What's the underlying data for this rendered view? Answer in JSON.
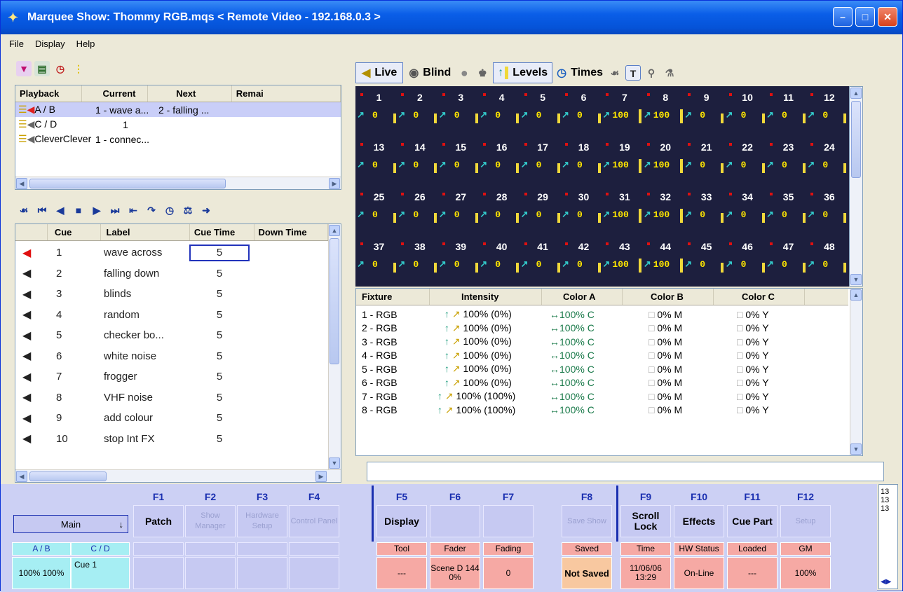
{
  "window": {
    "title": "Marquee Show: Thommy RGB.mqs  < Remote Video - 192.168.0.3 >"
  },
  "menu": [
    "File",
    "Display",
    "Help"
  ],
  "playback": {
    "headers": [
      "Playback",
      "Current",
      "Next",
      "Remai"
    ],
    "rows": [
      {
        "name": "A / B",
        "current": "1 - wave a...",
        "next": "2 - falling ..."
      },
      {
        "name": "C / D",
        "current": "1",
        "next": ""
      },
      {
        "name": "CleverClever",
        "current": "1 - connec...",
        "next": ""
      }
    ]
  },
  "cues": {
    "headers": [
      "Cue",
      "Label",
      "Cue Time",
      "Down Time"
    ],
    "rows": [
      {
        "cue": "1",
        "label": "wave across",
        "time": "5"
      },
      {
        "cue": "2",
        "label": "falling down",
        "time": "5"
      },
      {
        "cue": "3",
        "label": "blinds",
        "time": "5"
      },
      {
        "cue": "4",
        "label": "random",
        "time": "5"
      },
      {
        "cue": "5",
        "label": "checker bo...",
        "time": "5"
      },
      {
        "cue": "6",
        "label": "white noise",
        "time": "5"
      },
      {
        "cue": "7",
        "label": "frogger",
        "time": "5"
      },
      {
        "cue": "8",
        "label": "VHF noise",
        "time": "5"
      },
      {
        "cue": "9",
        "label": "add colour",
        "time": "5"
      },
      {
        "cue": "10",
        "label": "stop Int FX",
        "time": "5"
      }
    ]
  },
  "toolbar": {
    "live": "Live",
    "blind": "Blind",
    "levels": "Levels",
    "times": "Times"
  },
  "channels": {
    "numbers": [
      "1",
      "2",
      "3",
      "4",
      "5",
      "6",
      "7",
      "8",
      "9",
      "10",
      "11",
      "12",
      "13",
      "14",
      "15",
      "16",
      "17",
      "18",
      "19",
      "20",
      "21",
      "22",
      "23",
      "24",
      "25",
      "26",
      "27",
      "28",
      "29",
      "30",
      "31",
      "32",
      "33",
      "34",
      "35",
      "36",
      "37",
      "38",
      "39",
      "40",
      "41",
      "42",
      "43",
      "44",
      "45",
      "46",
      "47",
      "48"
    ],
    "levels": [
      "0",
      "0",
      "0",
      "0",
      "0",
      "0",
      "100",
      "100",
      "0",
      "0",
      "0",
      "0"
    ]
  },
  "fixtures": {
    "headers": [
      "Fixture",
      "Intensity",
      "Color A",
      "Color B",
      "Color C"
    ],
    "rows": [
      {
        "fixture": "1 - RGB",
        "intensity": "100% (0%)",
        "a": "↔100% C",
        "b": "0% M",
        "c": "0% Y"
      },
      {
        "fixture": "2 - RGB",
        "intensity": "100% (0%)",
        "a": "↔100% C",
        "b": "0% M",
        "c": "0% Y"
      },
      {
        "fixture": "3 - RGB",
        "intensity": "100% (0%)",
        "a": "↔100% C",
        "b": "0% M",
        "c": "0% Y"
      },
      {
        "fixture": "4 - RGB",
        "intensity": "100% (0%)",
        "a": "↔100% C",
        "b": "0% M",
        "c": "0% Y"
      },
      {
        "fixture": "5 - RGB",
        "intensity": "100% (0%)",
        "a": "↔100% C",
        "b": "0% M",
        "c": "0% Y"
      },
      {
        "fixture": "6 - RGB",
        "intensity": "100% (0%)",
        "a": "↔100% C",
        "b": "0% M",
        "c": "0% Y"
      },
      {
        "fixture": "7 - RGB",
        "intensity": "100% (100%)",
        "a": "↔100% C",
        "b": "0% M",
        "c": "0% Y"
      },
      {
        "fixture": "8 - RGB",
        "intensity": "100% (100%)",
        "a": "↔100% C",
        "b": "0% M",
        "c": "0% Y"
      }
    ]
  },
  "fkeys": [
    {
      "key": "F1",
      "label": "Patch",
      "enabled": true
    },
    {
      "key": "F2",
      "label": "Show Manager",
      "enabled": false
    },
    {
      "key": "F3",
      "label": "Hardware Setup",
      "enabled": false
    },
    {
      "key": "F4",
      "label": "Control Panel",
      "enabled": false
    },
    {
      "key": "F5",
      "label": "Display",
      "enabled": true
    },
    {
      "key": "F6",
      "label": "",
      "enabled": true
    },
    {
      "key": "F7",
      "label": "",
      "enabled": true
    },
    {
      "key": "F8",
      "label": "Save Show",
      "enabled": false
    },
    {
      "key": "F9",
      "label": "Scroll Lock",
      "enabled": true
    },
    {
      "key": "F10",
      "label": "Effects",
      "enabled": true
    },
    {
      "key": "F11",
      "label": "Cue Part",
      "enabled": true
    },
    {
      "key": "F12",
      "label": "Setup",
      "enabled": false
    }
  ],
  "main_select": "Main",
  "faders": {
    "ab": "A / B",
    "cd": "C / D",
    "ab_values": "100% 100%",
    "cd_value": "Cue 1"
  },
  "status": [
    {
      "label": "Tool",
      "value": "---"
    },
    {
      "label": "Fader",
      "value": "Scene D 144 0%"
    },
    {
      "label": "Fading",
      "value": "0"
    },
    {
      "label": "Saved",
      "value": "Not Saved"
    },
    {
      "label": "Time",
      "value": "11/06/06 13:29"
    },
    {
      "label": "HW Status",
      "value": "On-Line"
    },
    {
      "label": "Loaded",
      "value": "---"
    },
    {
      "label": "GM",
      "value": "100%"
    }
  ],
  "side_numbers": [
    "13",
    "13",
    "13"
  ],
  "colors": {
    "titlebar": "#0a5ee8",
    "stage": "#1d1f3e",
    "level_text": "#ffe600",
    "fkey_label": "#1a2fb0",
    "status_pink": "#f6a9a4",
    "fader_cyan": "#a6eef3"
  }
}
